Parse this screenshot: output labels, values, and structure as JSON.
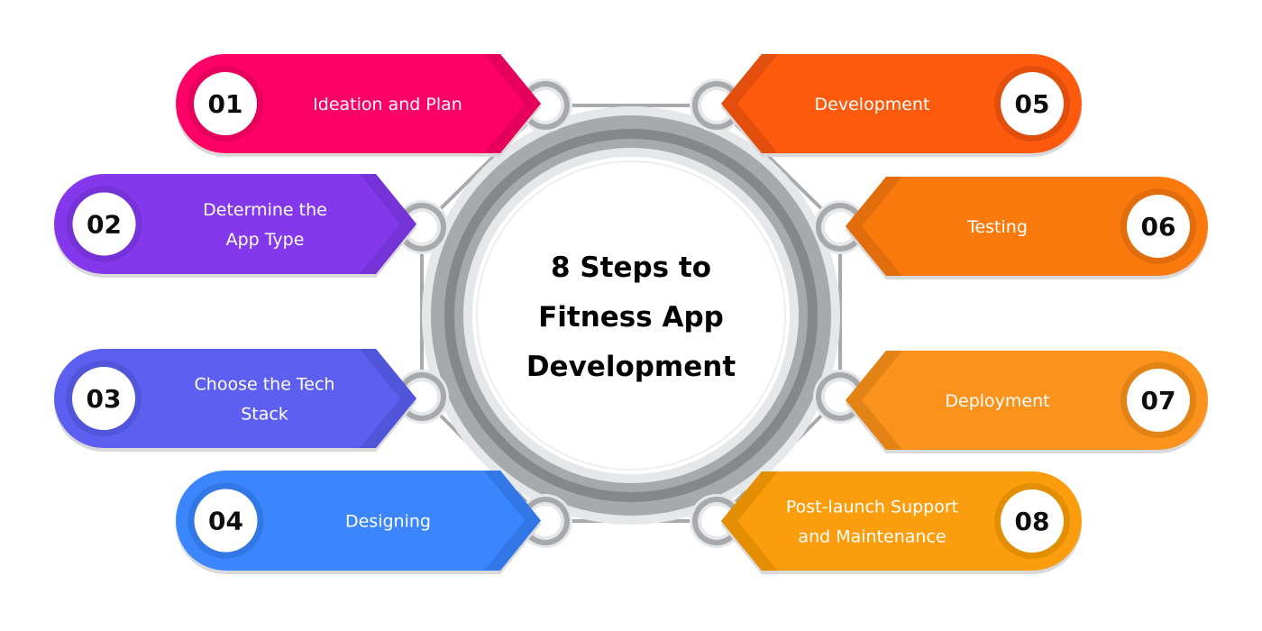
{
  "title": {
    "lines": [
      "8 Steps to",
      "Fitness App",
      "Development"
    ]
  },
  "steps": [
    {
      "number": "01",
      "label_lines": [
        "Ideation and Plan"
      ],
      "side": "left",
      "color": "#FF0066",
      "shade": "#E6005C"
    },
    {
      "number": "02",
      "label_lines": [
        "Determine the",
        "App Type"
      ],
      "side": "left",
      "color": "#8338EC",
      "shade": "#7530D6"
    },
    {
      "number": "03",
      "label_lines": [
        "Choose the Tech",
        "Stack"
      ],
      "side": "left",
      "color": "#5B5FEF",
      "shade": "#5154D9"
    },
    {
      "number": "04",
      "label_lines": [
        "Designing"
      ],
      "side": "left",
      "color": "#3A86FF",
      "shade": "#3277E6"
    },
    {
      "number": "05",
      "label_lines": [
        "Development"
      ],
      "side": "right",
      "color": "#FE5A0A",
      "shade": "#E24F08"
    },
    {
      "number": "06",
      "label_lines": [
        "Testing"
      ],
      "side": "right",
      "color": "#FB7A0E",
      "shade": "#E26D0B"
    },
    {
      "number": "07",
      "label_lines": [
        "Deployment"
      ],
      "side": "right",
      "color": "#FA921B",
      "shade": "#E38316"
    },
    {
      "number": "08",
      "label_lines": [
        "Post-launch Support",
        "and Maintenance"
      ],
      "side": "right",
      "color": "#FB9D08",
      "shade": "#E38D06"
    }
  ],
  "ring_colors": {
    "outer": "#A7A9AC",
    "mid": "#85878A",
    "light": "#E6E7E8",
    "node": "#A7A9AC"
  }
}
